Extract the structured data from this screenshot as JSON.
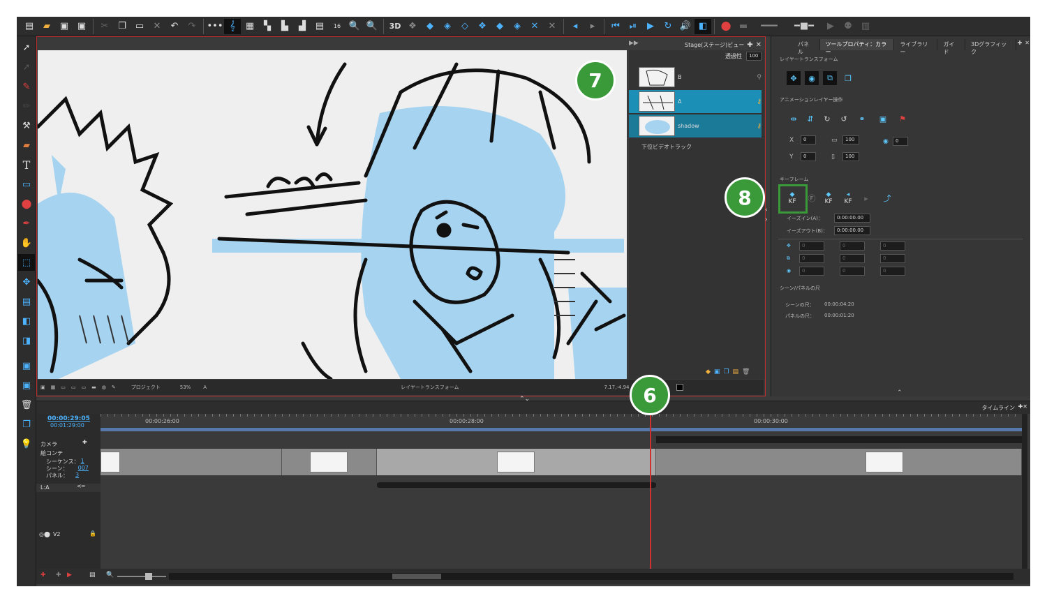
{
  "stage": {
    "title": "Stage(ステージ)ビュー",
    "opacity_label": "透過性",
    "opacity_value": "100",
    "footer_project": "プロジェクト",
    "footer_zoom": "53%",
    "footer_layer": "A",
    "footer_mode": "レイヤートランスフォーム",
    "footer_coords": "7.17,-4.94"
  },
  "layers": [
    {
      "name": "B",
      "selected": false
    },
    {
      "name": "A",
      "selected": true
    },
    {
      "name": "shadow",
      "selected": true
    }
  ],
  "lower_video_track": "下位ビデオトラック",
  "props": {
    "tabs": [
      "パネル",
      "ツールプロパティ：カラー",
      "ライブラリー",
      "ガイド",
      "3Dグラフィック"
    ],
    "active_tab": 1,
    "layer_transform": "レイヤートランスフォーム",
    "anim_layer_ops": "アニメーションレイヤー操作",
    "x_value": "0",
    "y_value": "0",
    "scale_w": "100",
    "scale_h": "100",
    "rotation": "0",
    "keyframe": "キーフレーム",
    "ease_in_label": "イーズイン(A)：",
    "ease_in_value": "0:00:00.00",
    "ease_out_label": "イーズアウト(B)：",
    "ease_out_value": "0:00:00.00",
    "grid": [
      "0",
      "0",
      "0",
      "0",
      "0",
      "0",
      "0",
      "0",
      "0"
    ],
    "duration_section": "シーン/パネルの尺",
    "scene_dur_label": "シーンの尺：",
    "scene_dur_value": "00:00:04:20",
    "panel_dur_label": "パネルの尺：",
    "panel_dur_value": "00:00:01:20"
  },
  "timeline": {
    "title": "タイムライン",
    "current_time": "00:00:29:05",
    "total_time": "00:01:29:00",
    "ticks": [
      "00:00:26:00",
      "00:00:28:00",
      "00:00:30:00"
    ],
    "camera": "カメラ",
    "storyboard": "絵コンテ",
    "sequence_label": "シーケンス：",
    "sequence_value": "1",
    "scene_label": "シーン：",
    "scene_value": "007",
    "panel_label": "パネル：",
    "panel_value": "3",
    "layer_track": "L:A",
    "video_track": "V2"
  },
  "badges": [
    "6",
    "7",
    "8"
  ],
  "colors": {
    "accent": "#1b8fb5",
    "badge": "#3a9a3a",
    "playhead": "#d03030"
  }
}
